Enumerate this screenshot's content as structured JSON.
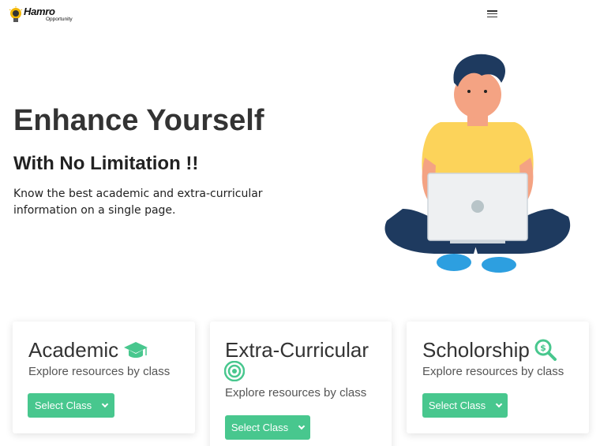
{
  "brand": {
    "name": "Hamro",
    "tagline": "Opportunity"
  },
  "nav": {
    "menu_icon": "hamburger-menu-icon"
  },
  "hero": {
    "title": "Enhance Yourself",
    "subtitle": "With No Limitation !!",
    "description": "Know the best academic and extra-curricular information on a single page.",
    "illustration": "person-with-laptop-illustration"
  },
  "colors": {
    "accent": "#48c78e",
    "text": "#333333"
  },
  "cards": [
    {
      "title": "Academic",
      "icon": "graduation-cap-icon",
      "description": "Explore resources by class",
      "button_label": "Select Class"
    },
    {
      "title": "Extra-Curricular",
      "icon": "target-icon",
      "description": "Explore resources by class",
      "button_label": "Select Class"
    },
    {
      "title": "Scholorship",
      "icon": "search-dollar-icon",
      "description": "Explore resources by class",
      "button_label": "Select Class"
    }
  ]
}
